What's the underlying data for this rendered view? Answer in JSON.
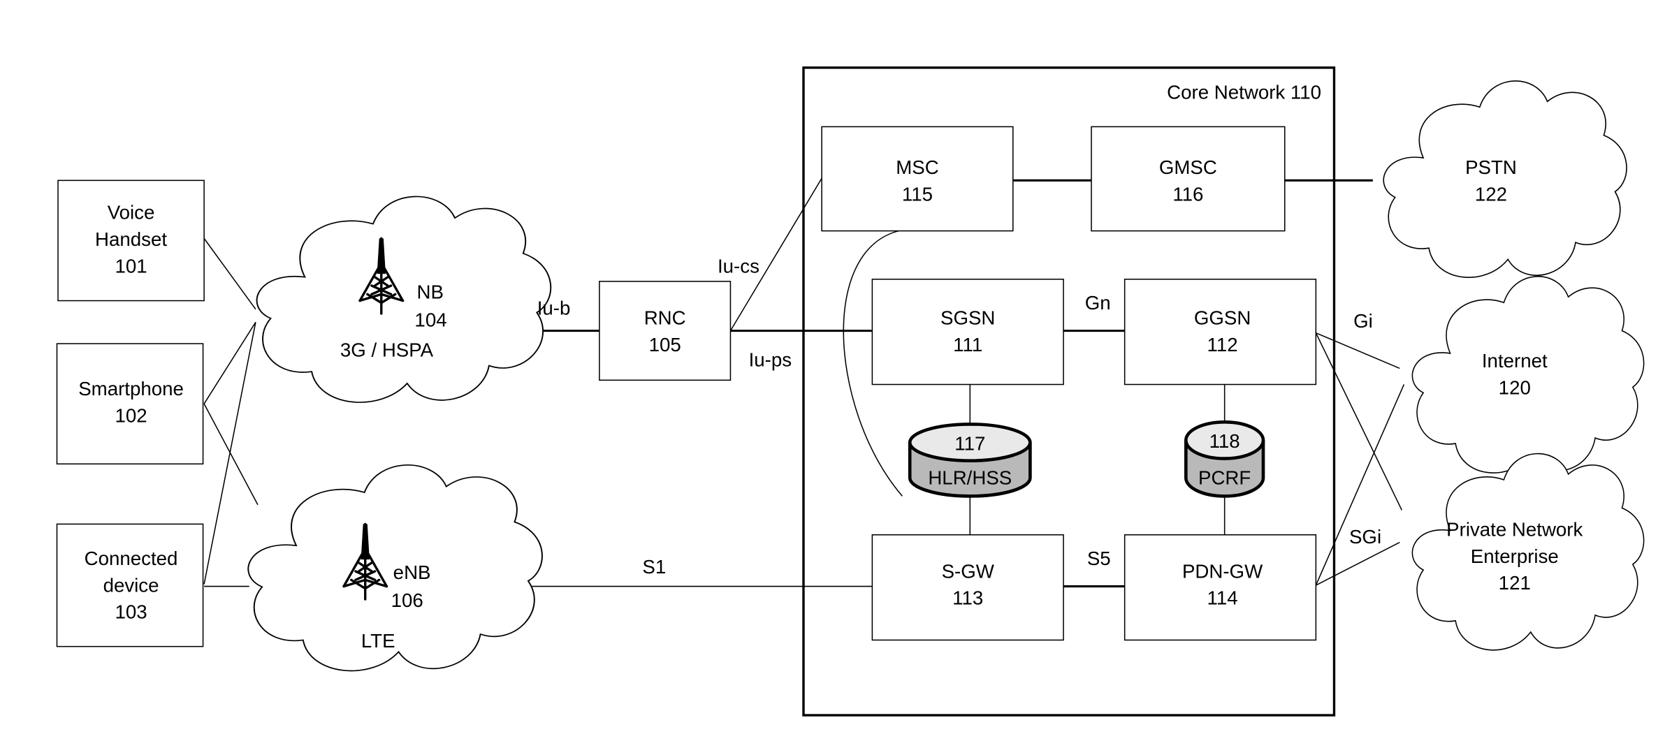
{
  "core_network": {
    "label": "Core Network 110"
  },
  "devices": [
    {
      "lines": [
        "Voice",
        "Handset",
        "101"
      ]
    },
    {
      "lines": [
        "Smartphone",
        "102"
      ]
    },
    {
      "lines": [
        "Connected",
        "device",
        "103"
      ]
    }
  ],
  "radio_networks": [
    {
      "station": "NB",
      "number": "104",
      "type": "3G / HSPA"
    },
    {
      "station": "eNB",
      "number": "106",
      "type": "LTE"
    }
  ],
  "rnc": {
    "name": "RNC",
    "number": "105"
  },
  "nodes": {
    "msc": {
      "name": "MSC",
      "number": "115"
    },
    "gmsc": {
      "name": "GMSC",
      "number": "116"
    },
    "sgsn": {
      "name": "SGSN",
      "number": "111"
    },
    "ggsn": {
      "name": "GGSN",
      "number": "112"
    },
    "sgw": {
      "name": "S-GW",
      "number": "113"
    },
    "pdngw": {
      "name": "PDN-GW",
      "number": "114"
    }
  },
  "databases": {
    "hlr": {
      "number": "117",
      "name": "HLR/HSS"
    },
    "pcrf": {
      "number": "118",
      "name": "PCRF"
    }
  },
  "external_networks": {
    "pstn": {
      "lines": [
        "PSTN",
        "122"
      ]
    },
    "internet": {
      "lines": [
        "Internet",
        "120"
      ]
    },
    "private": {
      "lines": [
        "Private Network",
        "Enterprise",
        "121"
      ]
    }
  },
  "interfaces": {
    "iub": "Iu-b",
    "iucs": "Iu-cs",
    "iups": "Iu-ps",
    "gn": "Gn",
    "gi": "Gi",
    "s1": "S1",
    "s5": "S5",
    "sgi": "SGi"
  }
}
